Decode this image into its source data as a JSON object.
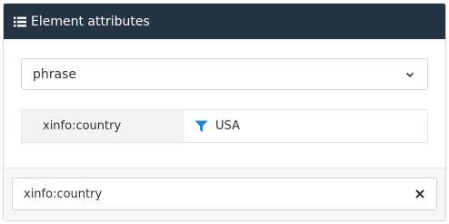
{
  "header": {
    "title": "Element attributes",
    "icon": "list-icon"
  },
  "select": {
    "value": "phrase",
    "icon": "chevron-down-icon"
  },
  "attribute": {
    "key": "xinfo:country",
    "value": "USA",
    "icon": "filter-icon",
    "icon_color": "#1a8ad6"
  },
  "footer": {
    "input_value": "xinfo:country",
    "clear_icon": "close-icon"
  },
  "colors": {
    "header_bg": "#243442",
    "key_bg": "#f3f3f3",
    "footer_bg": "#f7f7f7"
  }
}
